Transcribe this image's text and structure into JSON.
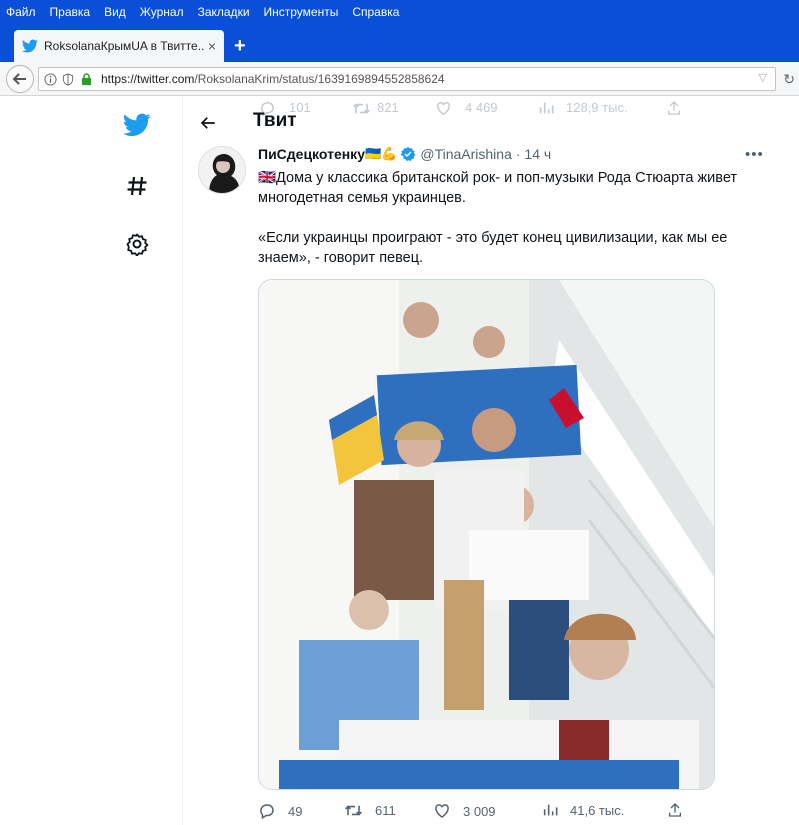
{
  "menu": [
    "Файл",
    "Правка",
    "Вид",
    "Журнал",
    "Закладки",
    "Инструменты",
    "Справка"
  ],
  "tab": {
    "title": "RoksolanaКрымUA в Твитте...",
    "close": "×",
    "new": "+"
  },
  "address": {
    "url_host": "https://twitter.com",
    "url_path": "/RoksolanaKrim/status/1639169894552858624"
  },
  "header": {
    "title": "Твит"
  },
  "faded_stats": {
    "replies": "101",
    "retweets": "821",
    "likes": "4 469",
    "views": "128,9 тыс."
  },
  "tweet": {
    "name": "ПиСдецкотенку",
    "name_emoji": "🇺🇦💪",
    "handle": "@TinaArishina",
    "time": "· 14 ч",
    "more": "•••",
    "para1": "🇬🇧Дома у классика британской рок- и поп-музыки Рода Стюарта живет многодетная семья украинцев.",
    "para2": "«Если украинцы проиграют - это будет конец цивилизации, как мы ее знаем», - говорит певец."
  },
  "stats": {
    "replies": "49",
    "retweets": "611",
    "likes": "3 009",
    "views": "41,6 тыс."
  },
  "colors": {
    "twitter_blue": "#1d9bf0",
    "browser_blue": "#0a4fd8",
    "text": "#0f1419",
    "muted": "#536471"
  }
}
